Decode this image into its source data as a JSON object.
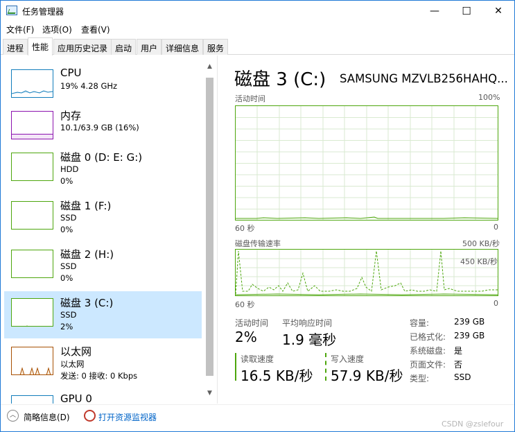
{
  "window": {
    "title": "任务管理器",
    "minimize": "—",
    "maximize": "☐",
    "close": "✕"
  },
  "menu": [
    "文件(F)",
    "选项(O)",
    "查看(V)"
  ],
  "tabs": [
    "进程",
    "性能",
    "应用历史记录",
    "启动",
    "用户",
    "详细信息",
    "服务"
  ],
  "active_tab": "性能",
  "resources": [
    {
      "name": "CPU",
      "line1": "19% 4.28 GHz",
      "line2": "",
      "color": "#117dbb"
    },
    {
      "name": "内存",
      "line1": "10.1/63.9 GB (16%)",
      "line2": "",
      "color": "#8b12ae"
    },
    {
      "name": "磁盘 0 (D: E: G:)",
      "line1": "HDD",
      "line2": "0%",
      "color": "#4da60c"
    },
    {
      "name": "磁盘 1 (F:)",
      "line1": "SSD",
      "line2": "0%",
      "color": "#4da60c"
    },
    {
      "name": "磁盘 2 (H:)",
      "line1": "SSD",
      "line2": "0%",
      "color": "#4da60c"
    },
    {
      "name": "磁盘 3 (C:)",
      "line1": "SSD",
      "line2": "2%",
      "color": "#4da60c"
    },
    {
      "name": "以太网",
      "line1": "以太网",
      "line2": "发送: 0 接收: 0 Kbps",
      "color": "#a74f01"
    },
    {
      "name": "GPU 0",
      "line1": "",
      "line2": "",
      "color": "#117dbb"
    }
  ],
  "selected_resource": 5,
  "detail": {
    "title": "磁盘 3 (C:)",
    "model": "SAMSUNG MZVLB256HAHQ...",
    "graph1": {
      "label": "活动时间",
      "max": "100%",
      "time": "60 秒",
      "zero": "0"
    },
    "graph2": {
      "label": "磁盘传输速率",
      "max": "500 KB/秒",
      "inner": "450 KB/秒",
      "time": "60 秒",
      "zero": "0"
    },
    "stats": {
      "active_time_label": "活动时间",
      "active_time": "2%",
      "response_label": "平均响应时间",
      "response": "1.9 毫秒",
      "read_label": "读取速度",
      "read": "16.5 KB/秒",
      "write_label": "写入速度",
      "write": "57.9 KB/秒"
    },
    "info": [
      {
        "k": "容量:",
        "v": "239 GB"
      },
      {
        "k": "已格式化:",
        "v": "239 GB"
      },
      {
        "k": "系统磁盘:",
        "v": "是"
      },
      {
        "k": "页面文件:",
        "v": "否"
      },
      {
        "k": "类型:",
        "v": "SSD"
      }
    ]
  },
  "footer": {
    "summary": "简略信息(D)",
    "monitor": "打开资源监视器"
  },
  "watermark": "CSDN @zslefour"
}
